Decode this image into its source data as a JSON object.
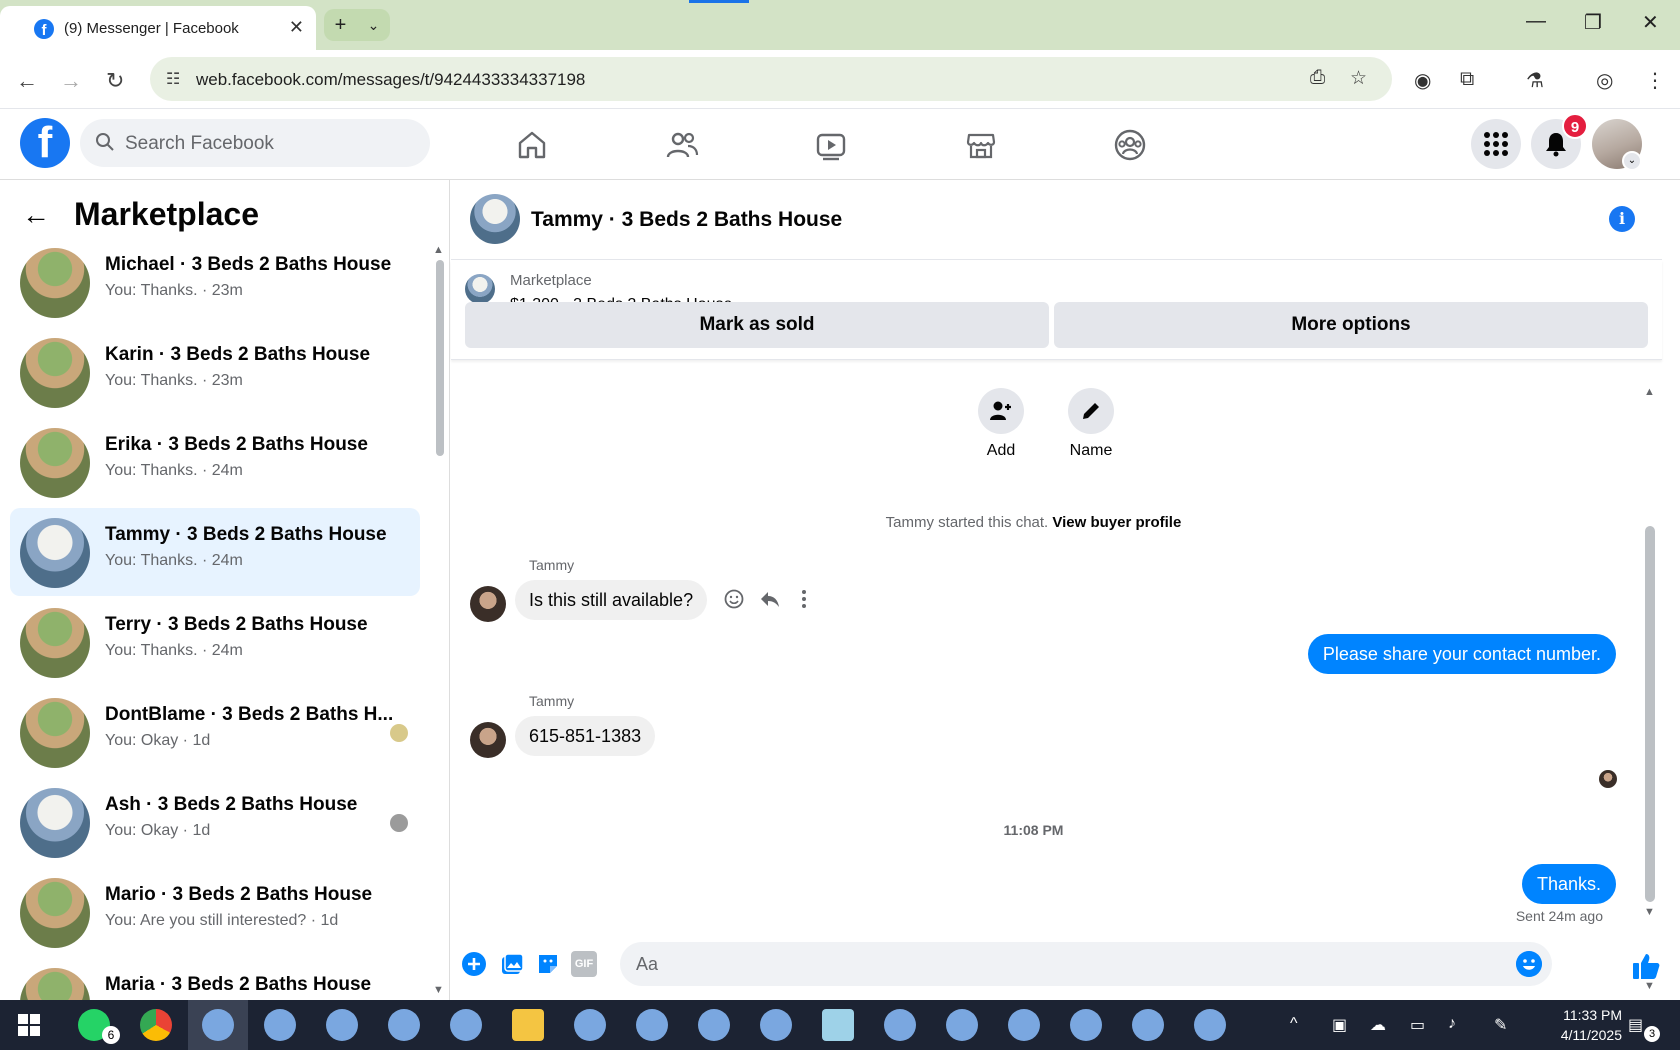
{
  "browser": {
    "tab_title": "(9) Messenger | Facebook",
    "url": "web.facebook.com/messages/t/9424433334337198"
  },
  "header": {
    "search_placeholder": "Search Facebook",
    "notification_count": "9"
  },
  "sidebar": {
    "title": "Marketplace",
    "conversations": [
      {
        "name": "Michael · 3 Beds 2 Baths House",
        "snippet": "You: Thanks. · 23m"
      },
      {
        "name": "Karin · 3 Beds 2 Baths House",
        "snippet": "You: Thanks. · 23m"
      },
      {
        "name": "Erika · 3 Beds 2 Baths House",
        "snippet": "You: Thanks. · 24m"
      },
      {
        "name": "Tammy · 3 Beds 2 Baths House",
        "snippet": "You: Thanks. · 24m"
      },
      {
        "name": "Terry · 3 Beds 2 Baths House",
        "snippet": "You: Thanks. · 24m"
      },
      {
        "name": "DontBlame · 3 Beds 2 Baths H...",
        "snippet": "You: Okay · 1d"
      },
      {
        "name": "Ash · 3 Beds 2 Baths House",
        "snippet": "You: Okay · 1d"
      },
      {
        "name": "Mario · 3 Beds 2 Baths House",
        "snippet": "You: Are you still interested? · 1d"
      },
      {
        "name": "Maria · 3 Beds 2 Baths House",
        "snippet": ""
      }
    ]
  },
  "chat": {
    "title": "Tammy · 3 Beds 2 Baths House",
    "marketplace_label": "Marketplace",
    "listing": "$1,300 - 3 Beds 2 Baths House",
    "mark_sold": "Mark as sold",
    "more_options": "More options",
    "add_label": "Add",
    "name_label": "Name",
    "system_text": "Tammy started this chat.",
    "system_link": "View buyer profile",
    "messages": [
      {
        "sender": "Tammy",
        "text": "Is this still available?"
      },
      {
        "sender": "You",
        "text": "Please share your contact number."
      },
      {
        "sender": "Tammy",
        "text": "615-851-1383"
      },
      {
        "sender": "You",
        "text": "Thanks."
      }
    ],
    "timestamp": "11:08 PM",
    "sent_status": "Sent 24m ago",
    "composer_placeholder": "Aa",
    "gif_label": "GIF"
  },
  "taskbar": {
    "time": "11:33 PM",
    "date": "4/11/2025",
    "whatsapp_badge": "6",
    "notif_badge": "3"
  },
  "colors": {
    "fb_blue": "#1877f2",
    "messenger_blue": "#0084ff",
    "active_conv": "#e7f3ff"
  }
}
